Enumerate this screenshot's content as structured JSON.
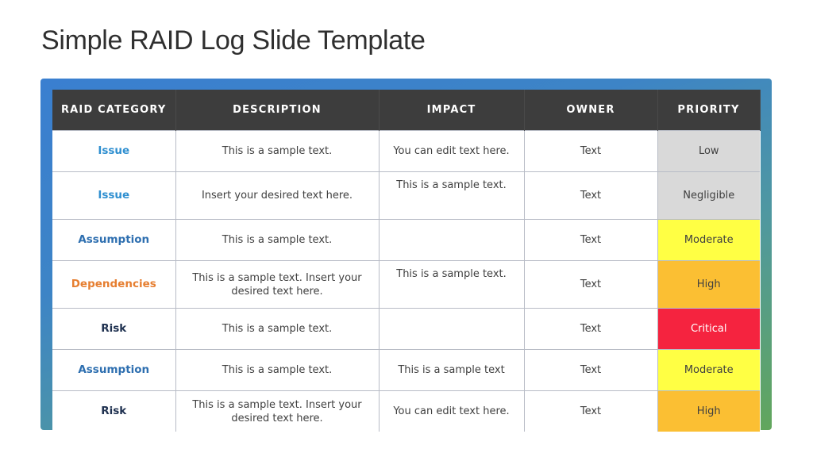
{
  "title": "Simple RAID Log Slide Template",
  "colors": {
    "header_bg": "#3d3d3d",
    "category_issue": "#2f8fd0",
    "category_assumption": "#2e6fb0",
    "category_dependencies": "#e67e30",
    "category_risk": "#1f3150",
    "priority_low": "#d9d9d9",
    "priority_negligible": "#d9d9d9",
    "priority_moderate": "#ffff44",
    "priority_high": "#fbbf33",
    "priority_critical": "#f5233f"
  },
  "table": {
    "headers": [
      "RAID CATEGORY",
      "DESCRIPTION",
      "IMPACT",
      "OWNER",
      "PRIORITY"
    ],
    "rows": [
      {
        "category": "Issue",
        "category_color": "#2f8fd0",
        "description": "This is a sample text.",
        "impact": "You can edit text here.",
        "impact_top": false,
        "owner": "Text",
        "priority": "Low",
        "priority_bg": "#d9d9d9",
        "priority_color": "#404040"
      },
      {
        "category": "Issue",
        "category_color": "#2f8fd0",
        "description": "Insert your desired text here.",
        "impact": "This is a sample text.",
        "impact_top": true,
        "owner": "Text",
        "priority": "Negligible",
        "priority_bg": "#d9d9d9",
        "priority_color": "#404040"
      },
      {
        "category": "Assumption",
        "category_color": "#2e6fb0",
        "description": "This is a sample text.",
        "impact": "",
        "impact_top": false,
        "owner": "Text",
        "priority": "Moderate",
        "priority_bg": "#ffff44",
        "priority_color": "#404040"
      },
      {
        "category": "Dependencies",
        "category_color": "#e67e30",
        "description": "This is a sample text. Insert your desired text here.",
        "impact": "This is a sample text.",
        "impact_top": true,
        "owner": "Text",
        "priority": "High",
        "priority_bg": "#fbbf33",
        "priority_color": "#404040"
      },
      {
        "category": "Risk",
        "category_color": "#1f3150",
        "description": "This is a sample text.",
        "impact": "",
        "impact_top": false,
        "owner": "Text",
        "priority": "Critical",
        "priority_bg": "#f5233f",
        "priority_color": "#ffffff"
      },
      {
        "category": "Assumption",
        "category_color": "#2e6fb0",
        "description": "This is a sample text.",
        "impact": "This is a sample text",
        "impact_top": false,
        "owner": "Text",
        "priority": "Moderate",
        "priority_bg": "#ffff44",
        "priority_color": "#404040"
      },
      {
        "category": "Risk",
        "category_color": "#1f3150",
        "description": "This is a sample text. Insert your desired text here.",
        "impact": "You can edit text here.",
        "impact_top": false,
        "owner": "Text",
        "priority": "High",
        "priority_bg": "#fbbf33",
        "priority_color": "#404040"
      }
    ]
  }
}
